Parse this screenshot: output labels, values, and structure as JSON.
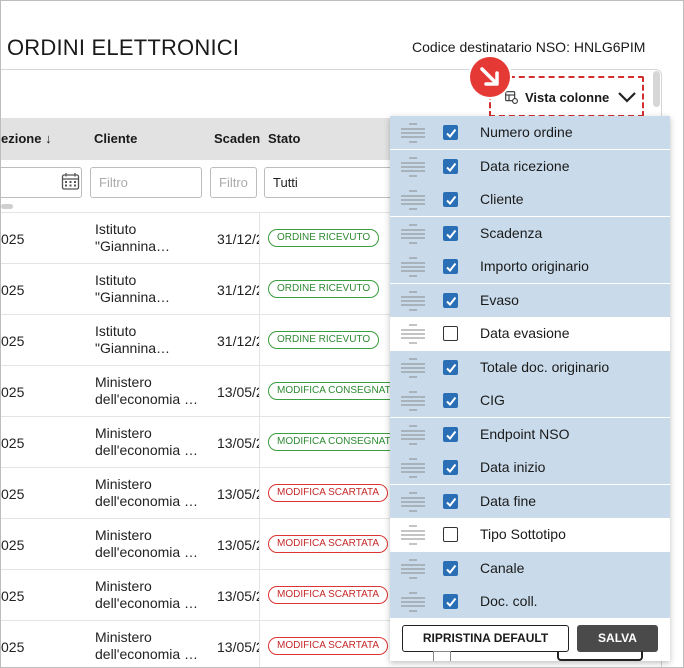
{
  "page": {
    "title": "ORDINI ELETTRONICI",
    "nso_code": "Codice destinatario NSO: HNLG6PIM"
  },
  "table": {
    "headers": {
      "data_ricezione": "ezione",
      "sort_indicator": "↓",
      "cliente": "Cliente",
      "scadenza": "Scaden",
      "stato": "Stato"
    },
    "filters": {
      "cliente_placeholder": "Filtro",
      "scadenza_placeholder": "Filtro",
      "stato_value": "Tutti"
    },
    "rows": [
      {
        "date": "025",
        "client1": "Istituto",
        "client2": "\"Giannina…",
        "scad": "31/12/2",
        "status": "ORDINE RICEVUTO"
      },
      {
        "date": "025",
        "client1": "Istituto",
        "client2": "\"Giannina…",
        "scad": "31/12/2",
        "status": "ORDINE RICEVUTO"
      },
      {
        "date": "025",
        "client1": "Istituto",
        "client2": "\"Giannina…",
        "scad": "31/12/2",
        "status": "ORDINE RICEVUTO"
      },
      {
        "date": "025",
        "client1": "Ministero",
        "client2": "dell'economia …",
        "scad": "13/05/2",
        "status": "MODIFICA CONSEGNATA"
      },
      {
        "date": "025",
        "client1": "Ministero",
        "client2": "dell'economia …",
        "scad": "13/05/2",
        "status": "MODIFICA CONSEGNATA"
      },
      {
        "date": "025",
        "client1": "Ministero",
        "client2": "dell'economia …",
        "scad": "13/05/2",
        "status": "MODIFICA SCARTATA"
      },
      {
        "date": "025",
        "client1": "Ministero",
        "client2": "dell'economia …",
        "scad": "13/05/2",
        "status": "MODIFICA SCARTATA"
      },
      {
        "date": "025",
        "client1": "Ministero",
        "client2": "dell'economia …",
        "scad": "13/05/2",
        "status": "MODIFICA SCARTATA"
      },
      {
        "date": "025",
        "client1": "Ministero",
        "client2": "dell'economia …",
        "scad": "13/05/2",
        "status": "MODIFICA SCARTATA"
      }
    ]
  },
  "vista_colonne": {
    "label": "Vista colonne",
    "options": [
      {
        "label": "Numero ordine",
        "checked": true
      },
      {
        "label": "Data ricezione",
        "checked": true
      },
      {
        "label": "Cliente",
        "checked": true
      },
      {
        "label": "Scadenza",
        "checked": true
      },
      {
        "label": "Importo originario",
        "checked": true
      },
      {
        "label": "Evaso",
        "checked": true
      },
      {
        "label": "Data evasione",
        "checked": false
      },
      {
        "label": "Totale doc. originario",
        "checked": true
      },
      {
        "label": "CIG",
        "checked": true
      },
      {
        "label": "Endpoint NSO",
        "checked": true
      },
      {
        "label": "Data inizio",
        "checked": true
      },
      {
        "label": "Data fine",
        "checked": true
      },
      {
        "label": "Tipo Sottotipo",
        "checked": false
      },
      {
        "label": "Canale",
        "checked": true
      },
      {
        "label": "Doc. coll.",
        "checked": true
      }
    ],
    "reset_label": "RIPRISTINA DEFAULT",
    "save_label": "SALVA"
  },
  "colors": {
    "checked_row": "#c9dbeb",
    "checkbox_blue": "#2a6fb5",
    "status_green": "#2e8a32",
    "status_red": "#c62828",
    "highlight_red": "#d32f2f"
  },
  "icons": {
    "calendar": "calendar-icon",
    "columns": "columns-settings-icon",
    "chevron": "chevron-down-icon",
    "drag": "drag-handle-icon",
    "pointer": "pointer-arrow-icon"
  }
}
